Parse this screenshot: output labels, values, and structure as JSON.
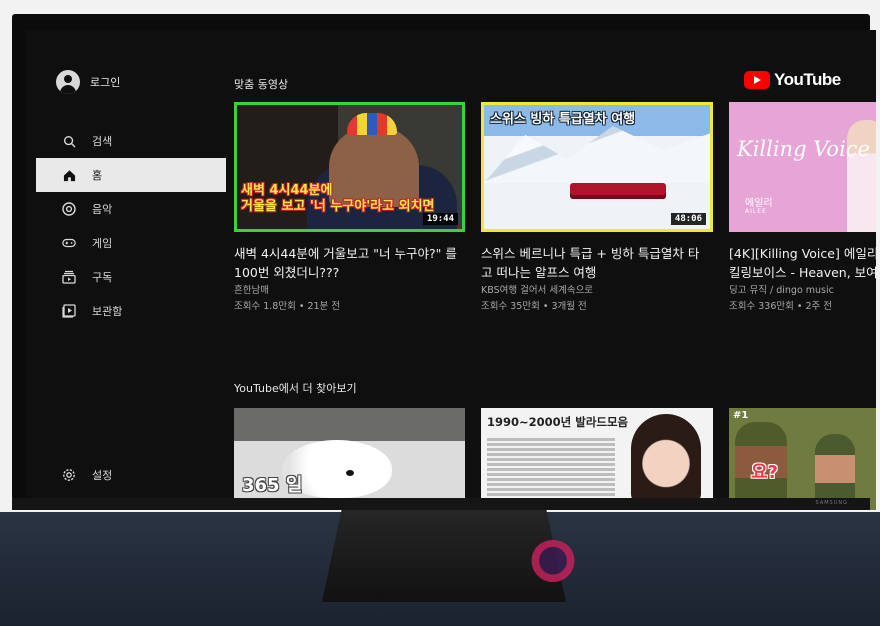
{
  "sidebar": {
    "login_label": "로그인",
    "items": [
      {
        "label": "검색",
        "icon": "search-icon"
      },
      {
        "label": "홈",
        "icon": "home-icon",
        "active": true
      },
      {
        "label": "음악",
        "icon": "music-icon"
      },
      {
        "label": "게임",
        "icon": "gamepad-icon"
      },
      {
        "label": "구독",
        "icon": "subscriptions-icon"
      },
      {
        "label": "보관함",
        "icon": "library-icon"
      }
    ],
    "settings_label": "설정"
  },
  "header": {
    "logo_text": "YouTube",
    "logo_color": "#ff0000"
  },
  "sections": [
    {
      "title": "맞춤 동영상",
      "videos": [
        {
          "thumb_caption_1": "새벽 4시44분에",
          "thumb_caption_2": "거울을 보고 '너 누구야'라고 외치면",
          "duration": "19:44",
          "title_1": "새벽 4시44분에 거울보고 \"너 누구야?\" 를",
          "title_2": "100번 외쳤더니???",
          "channel": "흔한남매",
          "meta": "조회수 1.8만회 • 21분 전"
        },
        {
          "thumb_caption": "스위스 빙하 특급열차 여행",
          "duration": "48:06",
          "title_1": "스위스 베르니나 특급 + 빙하 특급열차 타",
          "title_2": "고 떠나는 알프스 여행",
          "channel": "KBS여행 걸어서 세계속으로",
          "meta": "조회수 35만회 • 3개월 전"
        },
        {
          "thumb_caption_1": "Killing Voice",
          "thumb_caption_2": "에일리",
          "thumb_caption_3": "AILEE",
          "title_1": "[4K][Killing Voice] 에일리",
          "title_2": "킬링보이스 - Heaven, 보여",
          "channel": "딩고 뮤직 / dingo music",
          "meta": "조회수 336만회 • 2주 전"
        }
      ]
    },
    {
      "title": "YouTube에서 더 찾아보기",
      "videos": [
        {
          "thumb_caption": "365 일"
        },
        {
          "thumb_caption": "1990~2000년 발라드모음"
        },
        {
          "thumb_caption": "#1",
          "thumb_caption_2": "요?"
        }
      ]
    }
  ],
  "tv": {
    "brand": "SAMSUNG"
  }
}
